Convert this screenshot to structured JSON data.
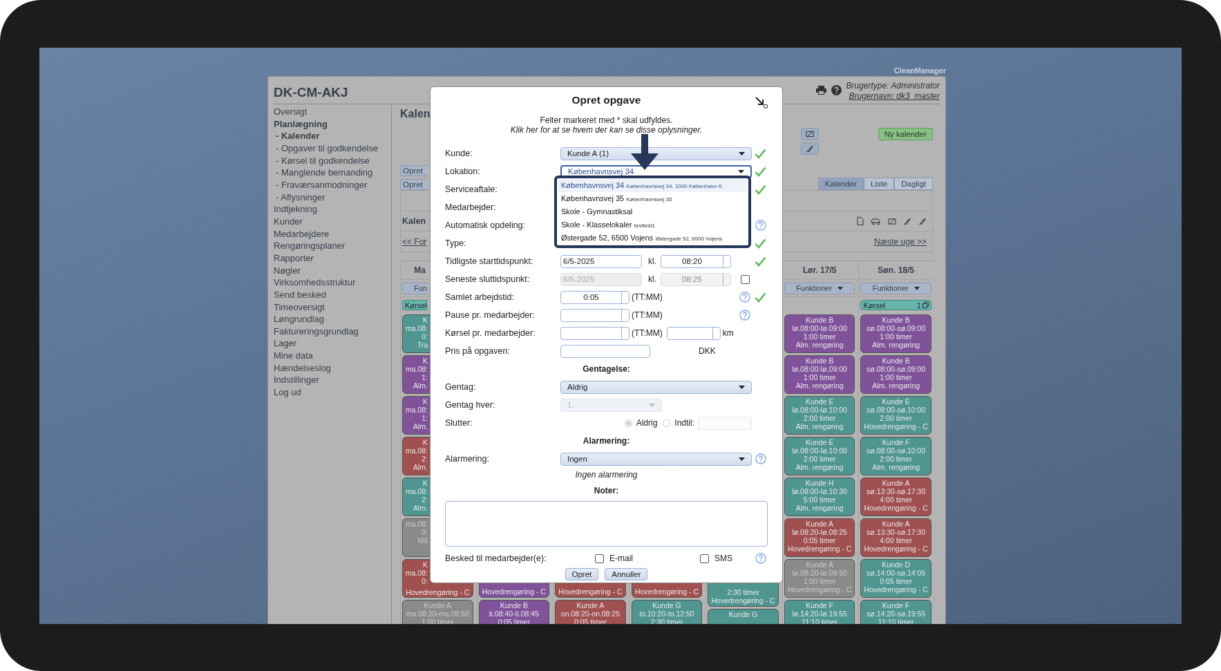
{
  "brand": "CleanManager",
  "header": {
    "title": "DK-CM-AKJ",
    "user_type": "Brugertype: Administrator",
    "user_name": "Brugernavn: dk3_master"
  },
  "sidebar": {
    "items": [
      {
        "label": "Oversigt",
        "selected": false
      },
      {
        "label": "Planlægning",
        "selected": true,
        "children": [
          {
            "label": "- Kalender",
            "selected": true
          },
          {
            "label": "- Opgaver til godkendelse",
            "selected": false
          },
          {
            "label": "- Kørsel til godkendelse",
            "selected": false
          },
          {
            "label": "- Manglende bemanding",
            "selected": false
          },
          {
            "label": "- Fraværsanmodninger",
            "selected": false
          },
          {
            "label": "- Aflysninger",
            "selected": false
          }
        ]
      },
      {
        "label": "Indtjekning",
        "selected": false
      },
      {
        "label": "Kunder",
        "selected": false
      },
      {
        "label": "Medarbejdere",
        "selected": false
      },
      {
        "label": "Rengøringsplaner",
        "selected": false
      },
      {
        "label": "Rapporter",
        "selected": false
      },
      {
        "label": "Nøgler",
        "selected": false
      },
      {
        "label": "Virksomhedsstruktur",
        "selected": false
      },
      {
        "label": "Send besked",
        "selected": false
      },
      {
        "label": "Timeoversigt",
        "selected": false
      },
      {
        "label": "Løngrundlag",
        "selected": false
      },
      {
        "label": "Faktureringsgrundlag",
        "selected": false
      },
      {
        "label": "Lager",
        "selected": false
      },
      {
        "label": "Mine data",
        "selected": false
      },
      {
        "label": "Hændelseslog",
        "selected": false
      },
      {
        "label": "Indstillinger",
        "selected": false
      },
      {
        "label": "Log ud",
        "selected": false
      }
    ]
  },
  "content": {
    "title": "Kalen",
    "create_buttons": [
      "Opret",
      "Opret"
    ],
    "new_calendar": "Ny kalender",
    "tabs": [
      {
        "label": "Kalender",
        "selected": true
      },
      {
        "label": "Liste",
        "selected": false
      },
      {
        "label": "Dagligt",
        "selected": false
      }
    ],
    "calendar_label": "Kalen",
    "prev_week": "<< For",
    "next_week": "Næste uge >>"
  },
  "calendar": {
    "columns": [
      {
        "kind": "clipped",
        "day": "Ma",
        "menu": "Fun",
        "trip": {
          "label": "Kørsel"
        },
        "cards": [
          {
            "kind": "clipped",
            "color": "#4f9590",
            "lines": [
              "K",
              "ma.08:",
              "0:",
              "Tra"
            ]
          },
          {
            "kind": "clipped",
            "color": "#80529a",
            "lines": [
              "K",
              "ma.08:",
              "1:",
              "Alm."
            ]
          },
          {
            "kind": "clipped",
            "color": "#80529a",
            "lines": [
              "K",
              "ma.08:",
              "1:",
              "Alm."
            ]
          },
          {
            "kind": "clipped",
            "color": "#a0504f",
            "lines": [
              "K",
              "ma.08:",
              "2:",
              "Alm."
            ]
          },
          {
            "kind": "clipped",
            "color": "#4f9590",
            "lines": [
              "K",
              "ma.08:",
              "2:",
              "Alm."
            ]
          },
          {
            "kind": "clipped",
            "color": "#8a8a8a",
            "lines": [
              "ma.08:",
              "0:",
              "Må"
            ]
          },
          {
            "kind": "clipped",
            "color": "#a0504f",
            "lines": [
              "K",
              "ma.08:",
              "0:"
            ],
            "tail": [
              "Hovedrengøring - C"
            ]
          },
          {
            "kind": "full",
            "color": "#8a8a8a",
            "lines": [
              "Kunde A",
              "ma.08:20-ma.09:50",
              "1:00 timer"
            ]
          }
        ]
      },
      {
        "kind": "covered",
        "cards": [
          {
            "kind": "tail",
            "color": "#80529a",
            "tail": [
              "Hovedrengøring - C"
            ]
          },
          {
            "kind": "full",
            "color": "#80529a",
            "lines": [
              "Kunde B",
              "ti.08:40-ti.08:45",
              "0:05 timer"
            ]
          }
        ]
      },
      {
        "kind": "covered",
        "cards": [
          {
            "kind": "tail",
            "color": "#a0504f",
            "tail": [
              "Hovedrengøring - C"
            ]
          },
          {
            "kind": "full",
            "color": "#a0504f",
            "lines": [
              "Kunde A",
              "on.08:20-on.08:25",
              "0:05 timer"
            ]
          }
        ]
      },
      {
        "kind": "covered",
        "cards": [
          {
            "kind": "tail",
            "color": "#a0504f",
            "tail": [
              "Hovedrengøring - C"
            ]
          },
          {
            "kind": "full",
            "color": "#4f9590",
            "lines": [
              "Kunde G",
              "to.10:20-to.12:50",
              "2:30 timer"
            ]
          }
        ]
      },
      {
        "kind": "covered",
        "cards": [
          {
            "kind": "tail",
            "color": "#4f9590",
            "tail": [
              "2:30 timer",
              "Hovedrengøring - C"
            ]
          },
          {
            "kind": "full",
            "color": "#4f9590",
            "lines": [
              "Kunde G"
            ]
          }
        ]
      },
      {
        "kind": "full",
        "day": "Lør. 17/5",
        "menu": "Funktioner",
        "cards": [
          {
            "kind": "full",
            "color": "#80529a",
            "lines": [
              "Kunde B",
              "lø.08:00-lø.09:00",
              "1:00 timer",
              "Alm. rengøring"
            ]
          },
          {
            "kind": "full",
            "color": "#80529a",
            "lines": [
              "Kunde B",
              "lø.08:00-lø.09:00",
              "1:00 timer",
              "Alm. rengøring"
            ]
          },
          {
            "kind": "full",
            "color": "#4f9590",
            "lines": [
              "Kunde E",
              "lø.08:00-lø.10:00",
              "2:00 timer",
              "Alm. rengøring"
            ]
          },
          {
            "kind": "full",
            "color": "#4f9590",
            "lines": [
              "Kunde E",
              "lø.08:00-lø.10:00",
              "2:00 timer",
              "Alm. rengøring"
            ]
          },
          {
            "kind": "full",
            "color": "#4f9590",
            "lines": [
              "Kunde H",
              "lø.08:00-lø.10:30",
              "5:00 timer",
              "Alm. rengøring"
            ]
          },
          {
            "kind": "full",
            "color": "#a0504f",
            "lines": [
              "Kunde A",
              "lø.08:20-lø.08:25",
              "0:05 timer",
              "Hovedrengøring - C"
            ]
          },
          {
            "kind": "full",
            "color": "#8a8a8a",
            "lines": [
              "Kunde A",
              "lø.08:20-lø.09:50",
              "1:00 timer",
              "Hovedrengøring - C"
            ]
          },
          {
            "kind": "full",
            "color": "#4f9590",
            "lines": [
              "Kunde F",
              "lø.14:20-lø.19:55",
              "11:10 timer"
            ]
          }
        ]
      },
      {
        "kind": "full",
        "day": "Søn. 18/5",
        "menu": "Funktioner",
        "trip": {
          "label": "Kørsel",
          "count": "1"
        },
        "cards": [
          {
            "kind": "full",
            "color": "#80529a",
            "lines": [
              "Kunde B",
              "sø.08:00-sø.09:00",
              "1:00 timer",
              "Alm. rengøring"
            ]
          },
          {
            "kind": "full",
            "color": "#80529a",
            "lines": [
              "Kunde B",
              "sø.08:00-sø.09:00",
              "1:00 timer",
              "Alm. rengøring"
            ]
          },
          {
            "kind": "full",
            "color": "#4f9590",
            "lines": [
              "Kunde E",
              "sø.08:00-sø.10:00",
              "2:00 timer",
              "Hovedrengøring - C"
            ]
          },
          {
            "kind": "full",
            "color": "#4f9590",
            "lines": [
              "Kunde F",
              "sø.08:00-sø.10:00",
              "2:00 timer",
              "Alm. rengøring"
            ]
          },
          {
            "kind": "full",
            "color": "#a0504f",
            "lines": [
              "Kunde A",
              "sø.13:30-sø.17:30",
              "4:00 timer",
              "Hovedrengøring - C"
            ]
          },
          {
            "kind": "full",
            "color": "#a0504f",
            "lines": [
              "Kunde A",
              "sø.13:30-sø.17:30",
              "4:00 timer",
              "Hovedrengøring - C"
            ]
          },
          {
            "kind": "full",
            "color": "#4f9590",
            "lines": [
              "Kunde D",
              "sø.14:00-sø.14:05",
              "0:05 timer",
              "Hovedrengøring - C"
            ]
          },
          {
            "kind": "full",
            "color": "#4f9590",
            "lines": [
              "Kunde F",
              "sø.14:20-sø.19:55",
              "11:10 timer"
            ]
          }
        ]
      }
    ]
  },
  "modal": {
    "title": "Opret opgave",
    "required_note": "Felter markeret med * skal udfyldes.",
    "info_link": "Klik her for at se hvem der kan se disse oplysninger.",
    "fields": [
      {
        "kind": "select",
        "label": "Kunde:",
        "value": "Kunde A (1)",
        "valid": true
      },
      {
        "kind": "select",
        "label": "Lokation:",
        "value": "Københavnsvej 34",
        "focused": true,
        "valid": true
      },
      {
        "kind": "covered",
        "label": "Serviceaftale:",
        "valid": true
      },
      {
        "kind": "covered",
        "label": "Medarbejder:"
      },
      {
        "kind": "covered",
        "label": "Automatisk opdeling:",
        "help": true
      },
      {
        "kind": "covered",
        "label": "Type:",
        "valid": true
      },
      {
        "kind": "datetime",
        "label": "Tidligste starttidspunkt:",
        "date": "6/5-2025",
        "kl": "kl.",
        "time": "08:20",
        "valid": true
      },
      {
        "kind": "datetime",
        "label": "Seneste sluttidspunkt:",
        "date": "6/5-2025",
        "kl": "kl.",
        "time": "08:25",
        "disabled": true,
        "checked": false
      },
      {
        "kind": "duration",
        "label": "Samlet arbejdstid:",
        "value": "0:05",
        "unit": "(TT:MM)",
        "valid": true,
        "help": true
      },
      {
        "kind": "duration",
        "label": "Pause pr. medarbejder:",
        "unit": "(TT:MM)",
        "help": true
      },
      {
        "kind": "duration",
        "label": "Kørsel pr. medarbejder:",
        "unit": "(TT:MM)",
        "km_unit": "km"
      },
      {
        "kind": "price",
        "label": "Pris på opgaven:",
        "currency": "DKK"
      },
      {
        "kind": "heading",
        "label": "Gentagelse:"
      },
      {
        "kind": "select",
        "label": "Gentag:",
        "value": "Aldrig"
      },
      {
        "kind": "small-select",
        "label": "Gentag hver:",
        "value": "1.",
        "disabled": true
      },
      {
        "kind": "radio",
        "label": "Slutter:",
        "disabled": true,
        "options": [
          {
            "label": "Aldrig",
            "selected": true
          },
          {
            "label": "Indtil:",
            "selected": false
          }
        ]
      },
      {
        "kind": "heading",
        "label": "Alarmering:"
      },
      {
        "kind": "select",
        "label": "Alarmering:",
        "value": "Ingen",
        "help": true
      },
      {
        "kind": "note",
        "label": "Ingen alarmering"
      },
      {
        "kind": "heading",
        "label": "Noter:"
      },
      {
        "kind": "textarea"
      },
      {
        "kind": "checks",
        "label": "Besked til medarbejder(e):",
        "options": [
          {
            "label": "E-mail",
            "checked": false
          },
          {
            "label": "SMS",
            "checked": false
          }
        ],
        "help": true
      }
    ],
    "buttons": [
      "Opret",
      "Annuller"
    ],
    "dropdown": {
      "options": [
        {
          "label": "Københavnsvej 34",
          "detail": "Københavnsvej 34, 1000 København K",
          "selected": true
        },
        {
          "label": "Københavnsvej 35",
          "detail": "Københavnsvej 35",
          "selected": false
        },
        {
          "label": "Skole - Gymnastiksal",
          "selected": false
        },
        {
          "label": "Skole - Klasselokaler",
          "detail": "testtest1",
          "selected": false
        },
        {
          "label": "Østergade 52, 6500 Vojens",
          "detail": "Østergade 52, 6500 Vojens",
          "selected": false
        }
      ]
    }
  }
}
